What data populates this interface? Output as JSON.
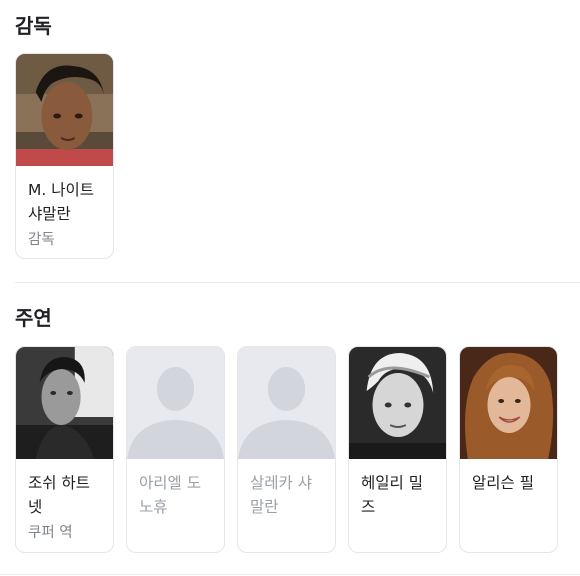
{
  "directors": {
    "title": "감독",
    "people": [
      {
        "name": "M. 나이트 샤말란",
        "role": "감독",
        "photo": "portrait"
      }
    ]
  },
  "cast": {
    "title": "주연",
    "people": [
      {
        "name": "조쉬 하트넷",
        "role": "쿠퍼 역",
        "photo": "portrait"
      },
      {
        "name": "아리엘 도노휴",
        "role": "",
        "photo": "placeholder"
      },
      {
        "name": "살레카 샤말란",
        "role": "",
        "photo": "placeholder"
      },
      {
        "name": "헤일리 밀즈",
        "role": "",
        "photo": "portrait"
      },
      {
        "name": "알리슨 필",
        "role": "",
        "photo": "portrait"
      }
    ]
  },
  "colors": {
    "placeholder_bg": "#e8e9ee",
    "placeholder_silhouette": "#d3d5dc",
    "name_dim": "#9aa0a6"
  }
}
